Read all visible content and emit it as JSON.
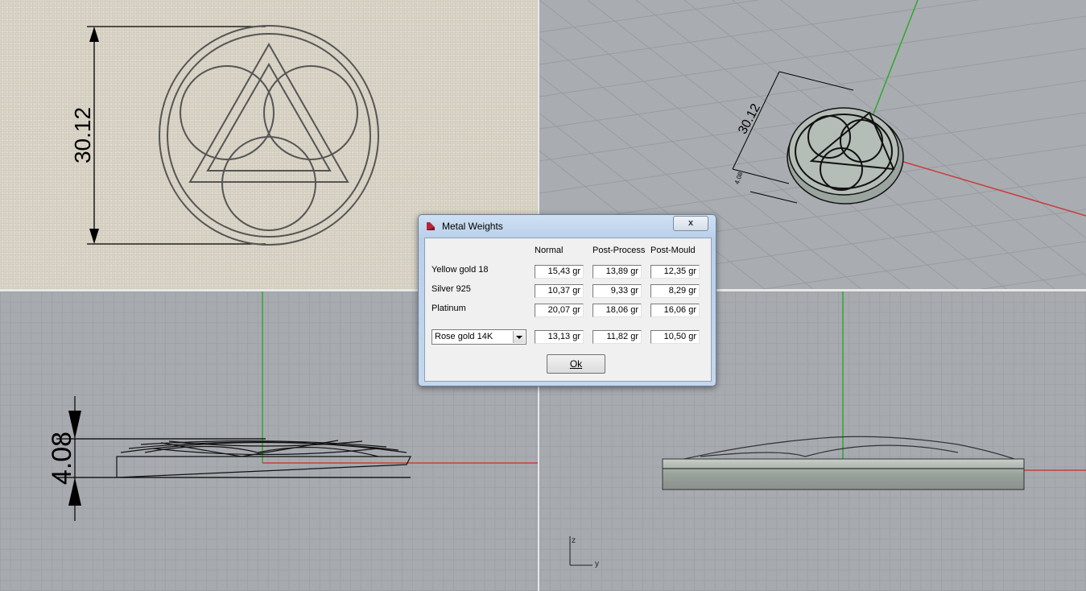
{
  "viewports": {
    "top": {
      "dimension": "30.12"
    },
    "perspective": {
      "dimension_long": "30.12",
      "dimension_short": "4.08"
    },
    "front": {
      "dimension": "4.08"
    },
    "right": {
      "axis_z": "z",
      "axis_y": "y"
    }
  },
  "dialog": {
    "title": "Metal Weights",
    "close_label": "x",
    "columns": [
      "Normal",
      "Post-Process",
      "Post-Mould"
    ],
    "rows": [
      {
        "label": "Yellow gold 18",
        "values": [
          "15,43 gr",
          "13,89 gr",
          "12,35 gr"
        ]
      },
      {
        "label": "Silver 925",
        "values": [
          "10,37 gr",
          "9,33 gr",
          "8,29 gr"
        ]
      },
      {
        "label": "Platinum",
        "values": [
          "20,07 gr",
          "18,06 gr",
          "16,06 gr"
        ]
      }
    ],
    "custom_row": {
      "selected_alloy": "Rose gold 14K",
      "values": [
        "13,13 gr",
        "11,82 gr",
        "10,50 gr"
      ]
    },
    "ok_label": "Ok"
  },
  "colors": {
    "x_axis": "#c83c3c",
    "y_axis": "#2fa82f",
    "viewport_border": "#e8e8e8"
  }
}
